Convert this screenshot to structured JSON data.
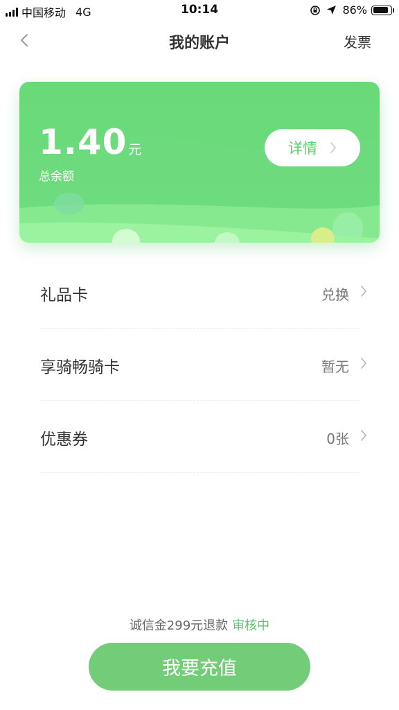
{
  "status_bar": {
    "carrier": "中国移动",
    "network": "4G",
    "time": "10:14",
    "battery": "86%",
    "battery_level": 0.86
  },
  "nav": {
    "title": "我的账户",
    "invoice_label": "发票",
    "back_icon": "chevron-left-icon"
  },
  "card": {
    "amount": "1.40",
    "unit": "元",
    "label": "总余额",
    "detail_label": "详情",
    "colors": {
      "card": "#6bdb7c",
      "accent": "#5ccf6e"
    }
  },
  "list": [
    {
      "title": "礼品卡",
      "value": "兑换"
    },
    {
      "title": "享骑畅骑卡",
      "value": "暂无"
    },
    {
      "title": "优惠券",
      "value": "0张"
    }
  ],
  "deposit": {
    "text": "诚信金299元退款",
    "status": "审核中"
  },
  "recharge_label": "我要充值"
}
